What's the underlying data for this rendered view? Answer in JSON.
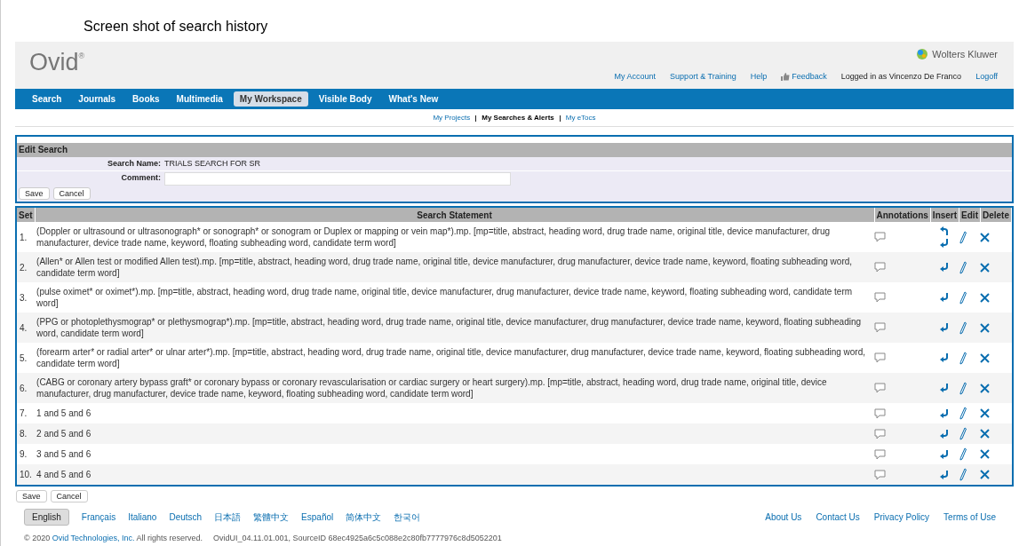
{
  "caption": "Screen shot of search history",
  "header": {
    "logo": "Ovid",
    "logo_mark": "®",
    "publisher": "Wolters Kluwer",
    "links": [
      {
        "label": "My Account",
        "kind": "link"
      },
      {
        "label": "Support & Training",
        "kind": "link"
      },
      {
        "label": "Help",
        "kind": "link"
      },
      {
        "label": "Feedback",
        "kind": "feedback"
      },
      {
        "label": "Logged in as Vincenzo De Franco",
        "kind": "text"
      },
      {
        "label": "Logoff",
        "kind": "link"
      }
    ]
  },
  "nav": [
    {
      "label": "Search",
      "selected": false
    },
    {
      "label": "Journals",
      "selected": false
    },
    {
      "label": "Books",
      "selected": false
    },
    {
      "label": "Multimedia",
      "selected": false
    },
    {
      "label": "My Workspace",
      "selected": true
    },
    {
      "label": "Visible Body",
      "selected": false
    },
    {
      "label": "What's New",
      "selected": false
    }
  ],
  "subnav": [
    {
      "label": "My Projects",
      "selected": false
    },
    {
      "label": "My Searches & Alerts",
      "selected": true
    },
    {
      "label": "My eTocs",
      "selected": false
    }
  ],
  "edit_search": {
    "title": "Edit Search",
    "name_label": "Search Name:",
    "name_value": "TRIALS SEARCH FOR SR",
    "comment_label": "Comment:",
    "buttons": [
      "Save",
      "Cancel"
    ]
  },
  "table": {
    "columns": [
      "Set",
      "Search Statement",
      "Annotations",
      "Insert",
      "Edit",
      "Delete"
    ],
    "rows": [
      {
        "set": "1.",
        "statement": "(Doppler or ultrasound or ultrasonograph* or sonograph* or sonogram or Duplex or mapping or vein map*).mp. [mp=title, abstract, heading word, drug trade name, original title, device manufacturer, drug manufacturer, device trade name, keyword, floating subheading word, candidate term word]",
        "insert_above": true
      },
      {
        "set": "2.",
        "statement": "(Allen* or Allen test or modified Allen test).mp. [mp=title, abstract, heading word, drug trade name, original title, device manufacturer, drug manufacturer, device trade name, keyword, floating subheading word, candidate term word]",
        "insert_above": false
      },
      {
        "set": "3.",
        "statement": "(pulse oximet* or oximet*).mp. [mp=title, abstract, heading word, drug trade name, original title, device manufacturer, drug manufacturer, device trade name, keyword, floating subheading word, candidate term word]",
        "insert_above": false
      },
      {
        "set": "4.",
        "statement": "(PPG or photoplethysmograp* or plethysmograp*).mp. [mp=title, abstract, heading word, drug trade name, original title, device manufacturer, drug manufacturer, device trade name, keyword, floating subheading word, candidate term word]",
        "insert_above": false
      },
      {
        "set": "5.",
        "statement": "(forearm arter* or radial arter* or ulnar arter*).mp. [mp=title, abstract, heading word, drug trade name, original title, device manufacturer, drug manufacturer, device trade name, keyword, floating subheading word, candidate term word]",
        "insert_above": false
      },
      {
        "set": "6.",
        "statement": "(CABG or coronary artery bypass graft* or coronary bypass or coronary revascularisation or cardiac surgery or heart surgery).mp. [mp=title, abstract, heading word, drug trade name, original title, device manufacturer, drug manufacturer, device trade name, keyword, floating subheading word, candidate term word]",
        "insert_above": false
      },
      {
        "set": "7.",
        "statement": "1 and 5 and 6",
        "insert_above": false
      },
      {
        "set": "8.",
        "statement": "2 and 5 and 6",
        "insert_above": false
      },
      {
        "set": "9.",
        "statement": "3 and 5 and 6",
        "insert_above": false
      },
      {
        "set": "10.",
        "statement": "4 and 5 and 6",
        "insert_above": false
      }
    ]
  },
  "bottom_buttons": [
    "Save",
    "Cancel"
  ],
  "languages": [
    {
      "label": "English",
      "selected": true
    },
    {
      "label": "Français",
      "selected": false
    },
    {
      "label": "Italiano",
      "selected": false
    },
    {
      "label": "Deutsch",
      "selected": false
    },
    {
      "label": "日本語",
      "selected": false
    },
    {
      "label": "繁體中文",
      "selected": false
    },
    {
      "label": "Español",
      "selected": false
    },
    {
      "label": "简体中文",
      "selected": false
    },
    {
      "label": "한국어",
      "selected": false
    }
  ],
  "footer_links": [
    "About Us",
    "Contact Us",
    "Privacy Policy",
    "Terms of Use"
  ],
  "copyright": {
    "prefix": "© 2020",
    "link": "Ovid Technologies, Inc.",
    "suffix": "All rights reserved.",
    "build": "OvidUI_04.11.01.001, SourceID 68ec4925a6c5c088e2c80fb7777976c8d5052201"
  }
}
